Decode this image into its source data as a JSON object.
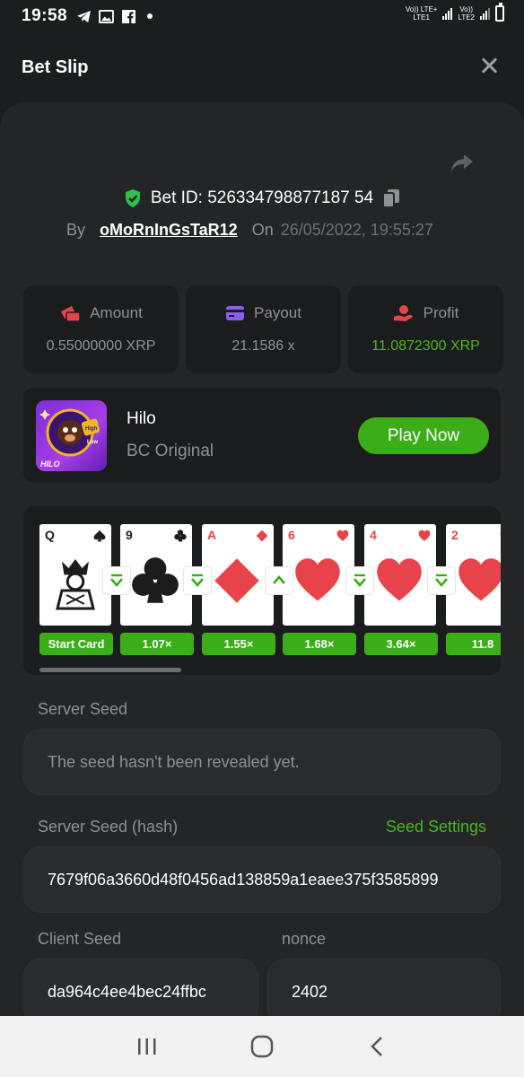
{
  "status": {
    "time": "19:58",
    "net1": "Vo)) LTE+",
    "net1b": "LTE1",
    "net2": "Vo))",
    "net2b": "LTE2"
  },
  "header": {
    "title": "Bet Slip"
  },
  "bet": {
    "id_text": "Bet ID: 526334798877187 54",
    "by_label": "By",
    "username": "oMoRnInGsTaR12",
    "on_label": "On",
    "date": "26/05/2022, 19:55:27"
  },
  "stats": [
    {
      "label": "Amount",
      "value": "0.55000000 XRP",
      "icon": "money-icon"
    },
    {
      "label": "Payout",
      "value": "21.1586 x",
      "icon": "card-icon"
    },
    {
      "label": "Profit",
      "value": "11.0872300 XRP",
      "icon": "hand-coin-icon"
    }
  ],
  "game": {
    "name": "Hilo",
    "subtitle": "BC Original",
    "play_label": "Play Now",
    "thumb_text": "HILO",
    "thumb_badge_top": "High",
    "thumb_badge_bottom": "Low"
  },
  "cards": [
    {
      "rank": "Q",
      "suit": "spade",
      "multiplier": "Start Card"
    },
    {
      "rank": "9",
      "suit": "club",
      "multiplier": "1.07×"
    },
    {
      "rank": "A",
      "suit": "diamond",
      "multiplier": "1.55×"
    },
    {
      "rank": "6",
      "suit": "heart",
      "multiplier": "1.68×"
    },
    {
      "rank": "4",
      "suit": "heart",
      "multiplier": "3.64×"
    },
    {
      "rank": "2",
      "suit": "heart",
      "multiplier": "11.8"
    }
  ],
  "arrows": [
    "down",
    "down",
    "up",
    "down",
    "down"
  ],
  "seeds": {
    "server_seed_label": "Server Seed",
    "server_seed_value": "The seed hasn't been revealed yet.",
    "server_hash_label": "Server Seed (hash)",
    "seed_settings_label": "Seed Settings",
    "server_hash_value": "7679f06a3660d48f0456ad138859a1eaee375f3585899",
    "client_seed_label": "Client Seed",
    "client_seed_value": "da964c4ee4bec24ffbc",
    "nonce_label": "nonce",
    "nonce_value": "2402"
  },
  "colors": {
    "accent_green": "#3bad17",
    "profit_green": "#4cb51a",
    "shield_green": "#2ec04a",
    "red": "#e8434a",
    "purple": "#8b5cf6"
  }
}
